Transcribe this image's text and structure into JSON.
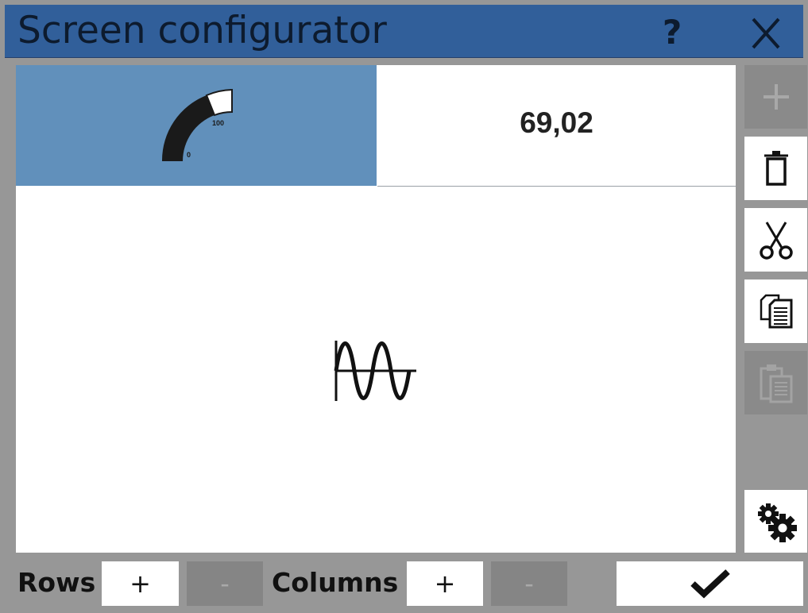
{
  "window": {
    "title": "Screen configurator",
    "help_label": "?",
    "title_bar_color": "#315f9a"
  },
  "grid": {
    "gauge_cell": {
      "icon": "gauge-icon",
      "scale_min": "0",
      "scale_max": "100",
      "background": "#6190bb"
    },
    "value_cell": {
      "value": "69,02"
    },
    "wave_cell": {
      "icon": "sine-wave-icon"
    }
  },
  "toolbar": [
    {
      "name": "add",
      "icon": "plus-icon",
      "enabled": false
    },
    {
      "name": "delete",
      "icon": "trash-icon",
      "enabled": true
    },
    {
      "name": "cut",
      "icon": "scissors-icon",
      "enabled": true
    },
    {
      "name": "copy",
      "icon": "copy-icon",
      "enabled": true
    },
    {
      "name": "paste",
      "icon": "paste-icon",
      "enabled": false
    },
    {
      "name": "settings",
      "icon": "gears-icon",
      "enabled": true
    }
  ],
  "bottom": {
    "rows_label": "Rows",
    "rows_add": "+",
    "rows_remove": "-",
    "columns_label": "Columns",
    "columns_add": "+",
    "columns_remove": "-",
    "confirm_icon": "checkmark-icon"
  }
}
